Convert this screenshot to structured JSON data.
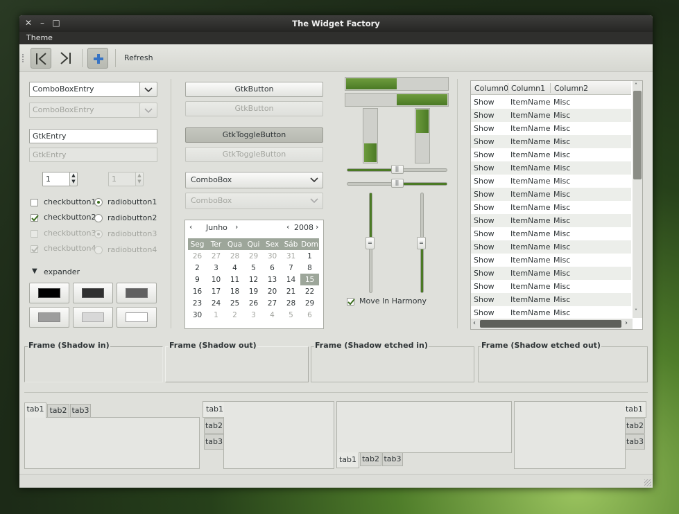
{
  "window": {
    "title": "The Widget Factory"
  },
  "menubar": {
    "theme": "Theme"
  },
  "toolbar": {
    "refresh": "Refresh"
  },
  "col1": {
    "combo_entry": "ComboBoxEntry",
    "combo_entry_dis": "ComboBoxEntry",
    "entry": "GtkEntry",
    "entry_dis": "GtkEntry",
    "spin1": "1",
    "spin2": "1",
    "checks": [
      "checkbutton1",
      "checkbutton2",
      "checkbutton3",
      "checkbutton4"
    ],
    "radios": [
      "radiobutton1",
      "radiobutton2",
      "radiobutton3",
      "radiobutton4"
    ],
    "expander": "expander"
  },
  "col2": {
    "button": "GtkButton",
    "button_dis": "GtkButton",
    "toggle": "GtkToggleButton",
    "toggle_dis": "GtkToggleButton",
    "combo": "ComboBox",
    "combo_dis": "ComboBox",
    "calendar": {
      "month": "Junho",
      "year": "2008",
      "weekdays": [
        "Seg",
        "Ter",
        "Qua",
        "Qui",
        "Sex",
        "Sáb",
        "Dom"
      ],
      "weeks": [
        [
          "26",
          "27",
          "28",
          "29",
          "30",
          "31",
          "1"
        ],
        [
          "2",
          "3",
          "4",
          "5",
          "6",
          "7",
          "8"
        ],
        [
          "9",
          "10",
          "11",
          "12",
          "13",
          "14",
          "15"
        ],
        [
          "16",
          "17",
          "18",
          "19",
          "20",
          "21",
          "22"
        ],
        [
          "23",
          "24",
          "25",
          "26",
          "27",
          "28",
          "29"
        ],
        [
          "30",
          "1",
          "2",
          "3",
          "4",
          "5",
          "6"
        ]
      ],
      "selected": "15"
    }
  },
  "col3": {
    "progress_h": [
      0.5,
      0.5
    ],
    "progress_v": [
      0.35,
      0.45
    ],
    "scale_h": [
      0.5,
      0.5
    ],
    "scale_v": [
      0.5,
      0.5
    ],
    "move_in_harmony": "Move In Harmony"
  },
  "tree": {
    "headers": [
      "Column0",
      "Column1",
      "Column2"
    ],
    "rows": [
      [
        "Show",
        "ItemName",
        "Misc"
      ],
      [
        "Show",
        "ItemName",
        "Misc"
      ],
      [
        "Show",
        "ItemName",
        "Misc"
      ],
      [
        "Show",
        "ItemName",
        "Misc"
      ],
      [
        "Show",
        "ItemName",
        "Misc"
      ],
      [
        "Show",
        "ItemName",
        "Misc"
      ],
      [
        "Show",
        "ItemName",
        "Misc"
      ],
      [
        "Show",
        "ItemName",
        "Misc"
      ],
      [
        "Show",
        "ItemName",
        "Misc"
      ],
      [
        "Show",
        "ItemName",
        "Misc"
      ],
      [
        "Show",
        "ItemName",
        "Misc"
      ],
      [
        "Show",
        "ItemName",
        "Misc"
      ],
      [
        "Show",
        "ItemName",
        "Misc"
      ],
      [
        "Show",
        "ItemName",
        "Misc"
      ],
      [
        "Show",
        "ItemName",
        "Misc"
      ],
      [
        "Show",
        "ItemName",
        "Misc"
      ],
      [
        "Show",
        "ItemName",
        "Misc"
      ]
    ]
  },
  "frames": [
    "Frame (Shadow in)",
    "Frame (Shadow out)",
    "Frame (Shadow etched in)",
    "Frame (Shadow etched out)"
  ],
  "notebooks": {
    "tabs": [
      "tab1",
      "tab2",
      "tab3"
    ]
  },
  "colors": {
    "accent": "#5a8a2f",
    "selected": "#9da69a",
    "titlebar": "#2c2c2a"
  }
}
